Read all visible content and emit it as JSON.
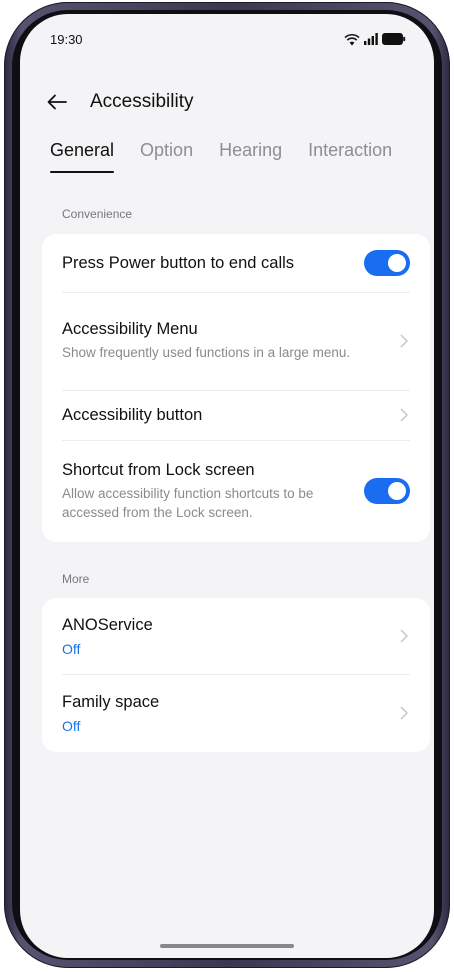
{
  "status_bar": {
    "time": "19:30",
    "icons": [
      "wifi-icon",
      "signal-icon",
      "battery-icon"
    ]
  },
  "header": {
    "back_icon": "arrow-left-icon",
    "title": "Accessibility"
  },
  "tabs": [
    {
      "label": "General",
      "active": true
    },
    {
      "label": "Option",
      "active": false
    },
    {
      "label": "Hearing",
      "active": false
    },
    {
      "label": "Interaction",
      "active": false
    }
  ],
  "sections": {
    "convenience": {
      "label": "Convenience",
      "items": [
        {
          "title": "Press Power button to end calls",
          "control": "toggle",
          "on": true
        },
        {
          "title": "Accessibility Menu",
          "subtitle": "Show frequently used functions in a large menu.",
          "control": "chevron"
        },
        {
          "title": "Accessibility button",
          "control": "chevron"
        },
        {
          "title": "Shortcut from Lock screen",
          "subtitle": "Allow accessibility function shortcuts to be accessed from the Lock screen.",
          "control": "toggle",
          "on": true
        }
      ]
    },
    "more": {
      "label": "More",
      "items": [
        {
          "title": "ANOService",
          "status": "Off",
          "control": "chevron"
        },
        {
          "title": "Family space",
          "status": "Off",
          "control": "chevron"
        }
      ]
    }
  },
  "colors": {
    "accent": "#1a6cf0",
    "status_blue": "#1a73e8",
    "background": "#f4f4f6"
  }
}
